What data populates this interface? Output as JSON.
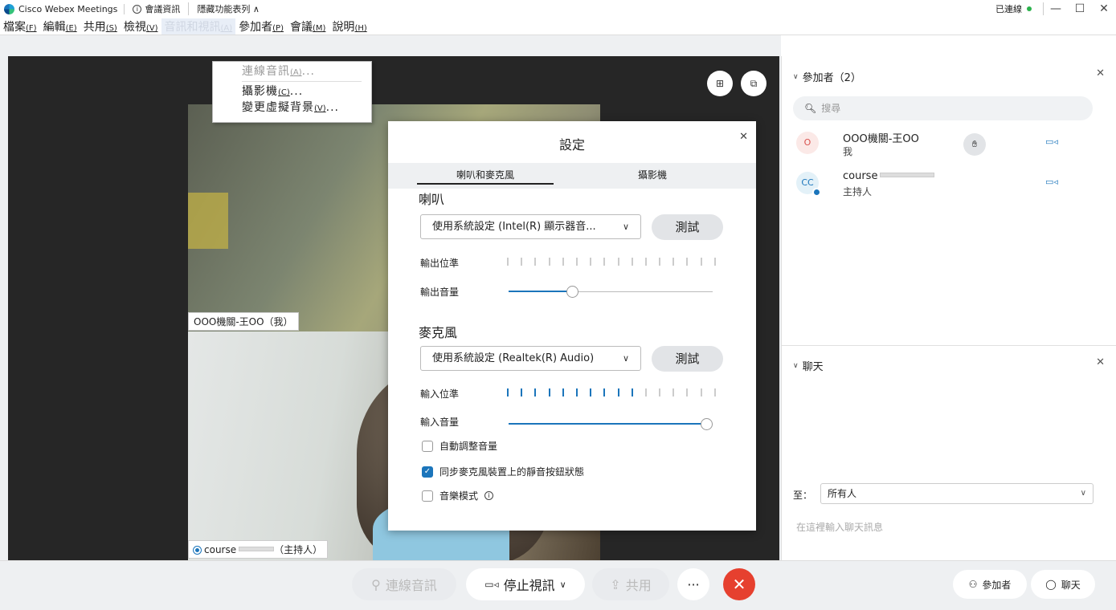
{
  "titlebar": {
    "app_name": "Cisco Webex Meetings",
    "meeting_info": "會議資訊",
    "hide_menu": "隱藏功能表列 ∧",
    "connected": "已連線",
    "minimize": "—",
    "maximize": "☐",
    "close": "✕"
  },
  "menubar": [
    {
      "label": "檔案",
      "key": "(F)"
    },
    {
      "label": "編輯",
      "key": "(E)"
    },
    {
      "label": "共用",
      "key": "(S)"
    },
    {
      "label": "檢視",
      "key": "(V)"
    },
    {
      "label": "音訊和視訊",
      "key": "(A)"
    },
    {
      "label": "參加者",
      "key": "(P)"
    },
    {
      "label": "會議",
      "key": "(M)"
    },
    {
      "label": "說明",
      "key": "(H)"
    }
  ],
  "dropdown": [
    {
      "label": "連線音訊",
      "key": "(A)",
      "suffix": "..."
    },
    {
      "label": "攝影機",
      "key": "(C)",
      "suffix": "..."
    },
    {
      "label": "變更虛擬背景",
      "key": "(V)",
      "suffix": "..."
    }
  ],
  "videos": {
    "self_label": "OOO機關-王OO（我）",
    "host_name": "course",
    "host_label": "（主持人）"
  },
  "settings": {
    "title": "設定",
    "tab_speaker_mic": "喇叭和麥克風",
    "tab_camera": "攝影機",
    "speaker_heading": "喇叭",
    "speaker_device": "使用系統設定 (Intel(R) 顯示器音...",
    "test": "測試",
    "output_level": "輸出位準",
    "output_volume": "輸出音量",
    "output_volume_value": 0.3,
    "mic_heading": "麥克風",
    "mic_device": "使用系統設定 (Realtek(R) Audio)",
    "input_level": "輸入位準",
    "input_level_active_ticks": 10,
    "input_volume": "輸入音量",
    "input_volume_value": 1.0,
    "auto_adjust": "自動調整音量",
    "auto_adjust_checked": false,
    "sync_mute": "同步麥克風裝置上的靜音按鈕狀態",
    "sync_mute_checked": true,
    "music_mode": "音樂模式",
    "music_mode_checked": false
  },
  "participants": {
    "header": "參加者（2）",
    "search_placeholder": "搜尋",
    "list": [
      {
        "initials": "O",
        "name": "OOO機關-王OO",
        "sub": "我"
      },
      {
        "initials": "CC",
        "name": "course",
        "sub": "主持人"
      }
    ]
  },
  "chat": {
    "header": "聊天",
    "to_label": "至：",
    "to_value": "所有人",
    "input_placeholder": "在這裡輸入聊天訊息"
  },
  "toolbar": {
    "connect_audio": "連線音訊",
    "stop_video": "停止視訊",
    "share": "共用",
    "more": "···",
    "end": "✕",
    "participants": "參加者",
    "chat": "聊天"
  },
  "colors": {
    "accent": "#1b75bb",
    "end_call": "#e6402f",
    "connected_dot": "#2bb24c"
  }
}
